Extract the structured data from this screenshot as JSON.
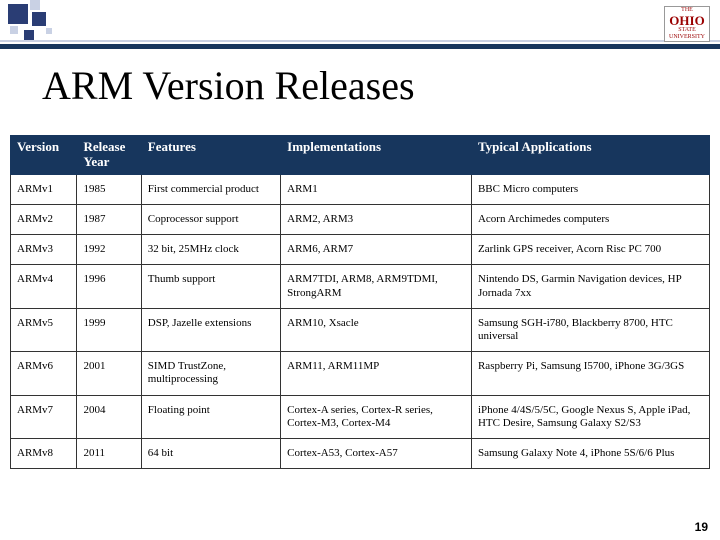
{
  "brand": {
    "line1": "THE",
    "line2": "OHIO",
    "line3": "STATE",
    "line4": "UNIVERSITY"
  },
  "title": "ARM Version Releases",
  "page_number": "19",
  "columns": [
    "Version",
    "Release Year",
    "Features",
    "Implementations",
    "Typical Applications"
  ],
  "rows": [
    {
      "version": "ARMv1",
      "year": "1985",
      "features": "First commercial product",
      "impl": "ARM1",
      "apps": "BBC Micro computers"
    },
    {
      "version": "ARMv2",
      "year": "1987",
      "features": "Coprocessor support",
      "impl": "ARM2, ARM3",
      "apps": "Acorn Archimedes computers"
    },
    {
      "version": "ARMv3",
      "year": "1992",
      "features": "32 bit, 25MHz clock",
      "impl": "ARM6, ARM7",
      "apps": "Zarlink GPS receiver, Acorn Risc PC 700"
    },
    {
      "version": "ARMv4",
      "year": "1996",
      "features": "Thumb support",
      "impl": "ARM7TDI, ARM8, ARM9TDMI, StrongARM",
      "apps": "Nintendo DS, Garmin Navigation devices, HP Jornada 7xx"
    },
    {
      "version": "ARMv5",
      "year": "1999",
      "features": "DSP, Jazelle extensions",
      "impl": "ARM10, Xsacle",
      "apps": "Samsung SGH-i780, Blackberry 8700, HTC universal"
    },
    {
      "version": "ARMv6",
      "year": "2001",
      "features": "SIMD TrustZone, multiprocessing",
      "impl": "ARM11, ARM11MP",
      "apps": "Raspberry Pi, Samsung I5700, iPhone 3G/3GS"
    },
    {
      "version": "ARMv7",
      "year": "2004",
      "features": "Floating point",
      "impl": "Cortex-A series, Cortex-R series, Cortex-M3, Cortex-M4",
      "apps": "iPhone 4/4S/5/5C, Google Nexus S, Apple iPad, HTC Desire, Samsung Galaxy S2/S3"
    },
    {
      "version": "ARMv8",
      "year": "2011",
      "features": "64 bit",
      "impl": "Cortex-A53, Cortex-A57",
      "apps": "Samsung Galaxy Note 4, iPhone 5S/6/6 Plus"
    }
  ]
}
